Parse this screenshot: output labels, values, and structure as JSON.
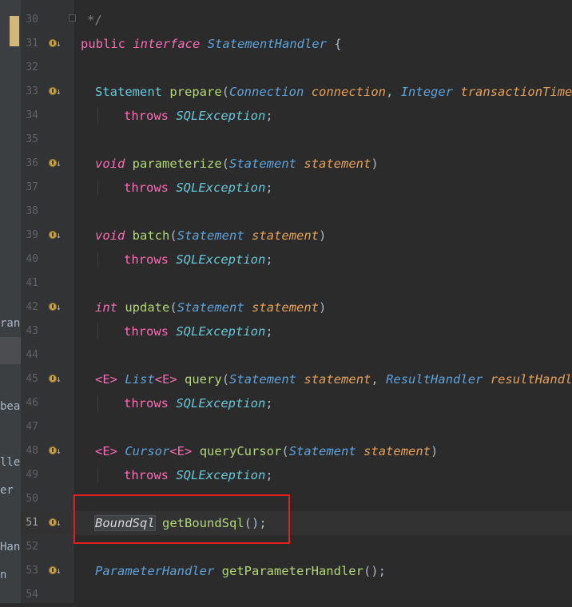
{
  "side_panel": {
    "fragments": [
      "ran",
      "bean",
      "ller",
      "er",
      "Hand",
      "n"
    ]
  },
  "code": {
    "lines": [
      {
        "num": "30",
        "text": "*/"
      },
      {
        "num": "31",
        "kw1": "public",
        "kw2": "interface",
        "name": "StatementHandler",
        "brace": "{"
      },
      {
        "num": "32"
      },
      {
        "num": "33",
        "t1": "Statement",
        "fn": "prepare",
        "p1": "(",
        "t2": "Connection",
        "a1": "connection",
        "c": ",",
        "t3": "Integer",
        "a2": "transactionTimeout"
      },
      {
        "num": "34",
        "kw": "throws",
        "ex": "SQLException",
        "end": ";"
      },
      {
        "num": "35"
      },
      {
        "num": "36",
        "kw": "void",
        "fn": "parameterize",
        "p1": "(",
        "t": "Statement",
        "a": "statement",
        "p2": ")"
      },
      {
        "num": "37",
        "kw": "throws",
        "ex": "SQLException",
        "end": ";"
      },
      {
        "num": "38"
      },
      {
        "num": "39",
        "kw": "void",
        "fn": "batch",
        "p1": "(",
        "t": "Statement",
        "a": "statement",
        "p2": ")"
      },
      {
        "num": "40",
        "kw": "throws",
        "ex": "SQLException",
        "end": ";"
      },
      {
        "num": "41"
      },
      {
        "num": "42",
        "kw": "int",
        "fn": "update",
        "p1": "(",
        "t": "Statement",
        "a": "statement",
        "p2": ")"
      },
      {
        "num": "43",
        "kw": "throws",
        "ex": "SQLException",
        "end": ";"
      },
      {
        "num": "44"
      },
      {
        "num": "45",
        "g1": "<E>",
        "t1": "List",
        "g2": "<E>",
        "fn": "query",
        "p1": "(",
        "t2": "Statement",
        "a1": "statement",
        "c": ",",
        "t3": "ResultHandler",
        "a2": "resultHandler)"
      },
      {
        "num": "46",
        "kw": "throws",
        "ex": "SQLException",
        "end": ";"
      },
      {
        "num": "47"
      },
      {
        "num": "48",
        "g1": "<E>",
        "t1": "Cursor",
        "g2": "<E>",
        "fn": "queryCursor",
        "p1": "(",
        "t2": "Statement",
        "a1": "statement",
        "p2": ")"
      },
      {
        "num": "49",
        "kw": "throws",
        "ex": "SQLException",
        "end": ";"
      },
      {
        "num": "50"
      },
      {
        "num": "51",
        "t": "BoundSql",
        "fn": "getBoundSql",
        "rest": "();"
      },
      {
        "num": "52"
      },
      {
        "num": "53",
        "t": "ParameterHandler",
        "fn": "getParameterHandler",
        "rest": "();"
      },
      {
        "num": "54"
      }
    ]
  },
  "colors": {
    "background": "#2b2b2b",
    "gutter": "#313335",
    "keyword": "#cc7832",
    "highlight_box": "#e01f1f"
  },
  "icons": [
    "implemented-method-icon",
    "fold-icon"
  ]
}
